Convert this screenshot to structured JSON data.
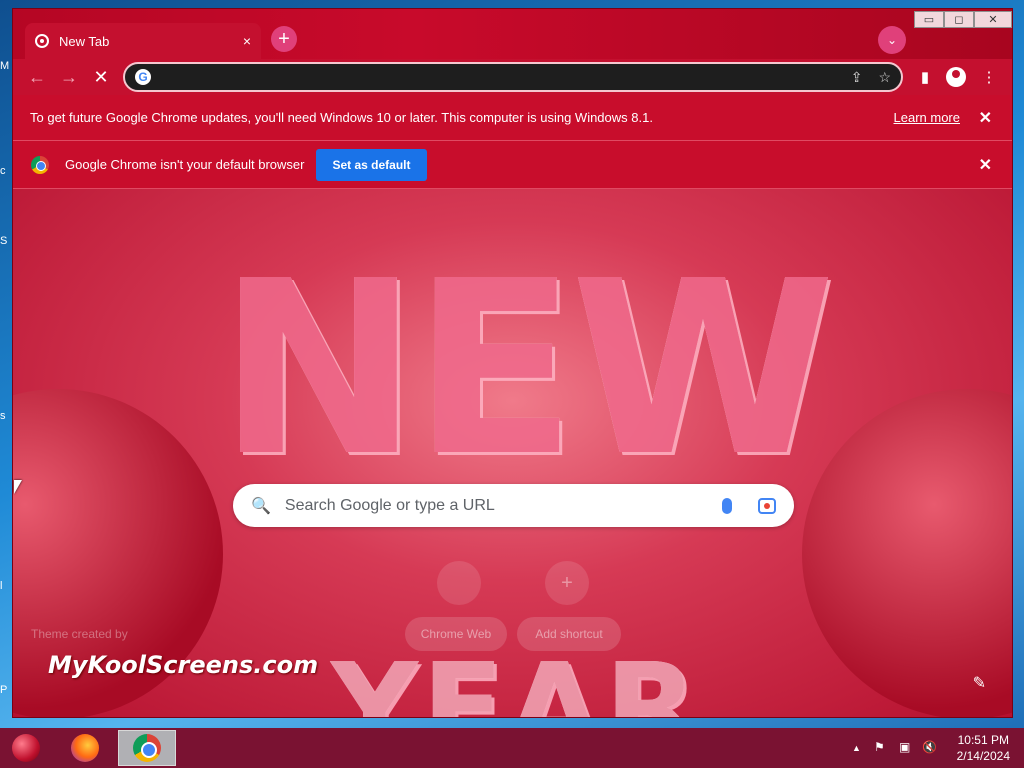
{
  "window": {
    "controls": {
      "minimize": "▭",
      "maximize": "◻",
      "close": "✕"
    }
  },
  "tabs": [
    {
      "label": "New Tab",
      "close_icon": "×"
    }
  ],
  "new_tab_icon": "+",
  "tab_search_icon": "⌄",
  "toolbar": {
    "back_icon": "←",
    "forward_icon": "→",
    "stop_icon": "✕",
    "address_value": "",
    "address_placeholder": "",
    "share_icon": "⇪",
    "bookmark_icon": "☆",
    "sidepanel_icon": "▮",
    "menu_icon": "⋮"
  },
  "update_bar": {
    "message": "To get future Google Chrome updates, you'll need Windows 10 or later. This computer is using Windows 8.1.",
    "link": "Learn more",
    "close": "✕"
  },
  "default_bar": {
    "message": "Google Chrome isn't your default browser",
    "button": "Set as default",
    "close": "✕"
  },
  "ntp": {
    "search_placeholder": "Search Google or type a URL",
    "search_icon": "🔍",
    "shortcuts": [
      {
        "label": "Chrome Web"
      },
      {
        "label": "Add shortcut"
      }
    ],
    "add_icon": "+",
    "theme_credit": "Theme created by",
    "brand": "MyKoolScreens.com",
    "customize_icon": "✎",
    "background_text_top": "NEW",
    "background_text_bottom": "YEAR"
  },
  "taskbar": {
    "tray_up": "▲",
    "flag_icon": "⚑",
    "network_icon": "▣",
    "volume_icon": "🔇",
    "time": "10:51 PM",
    "date": "2/14/2024"
  },
  "colors": {
    "accent": "#c4102f",
    "button": "#1a73e8",
    "taskbar": "#7a1232"
  }
}
